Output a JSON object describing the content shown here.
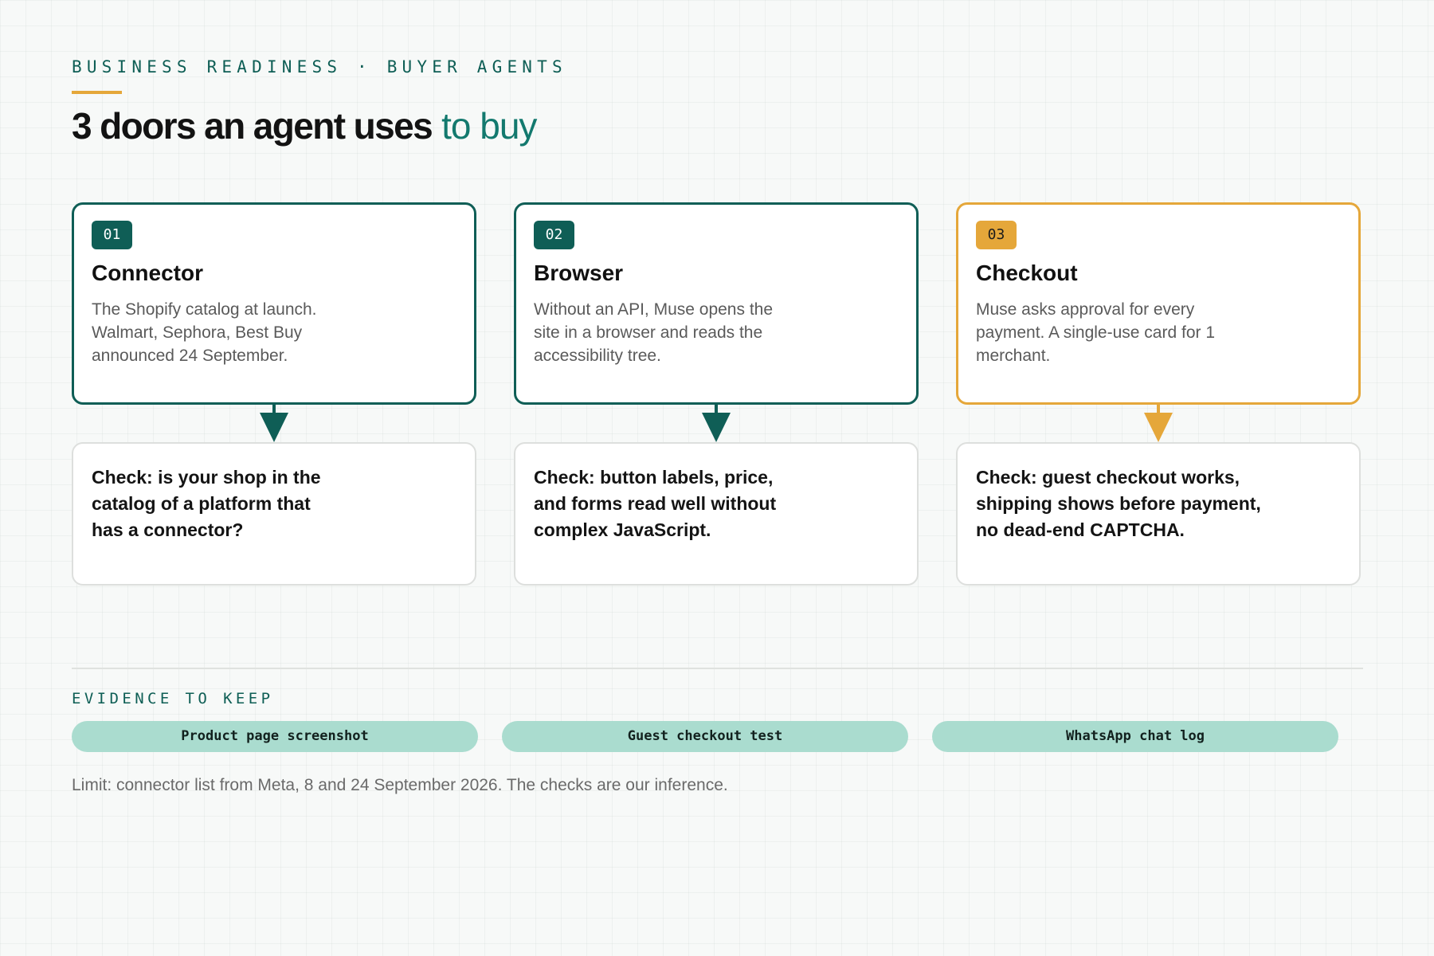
{
  "header": {
    "eyebrow": "BUSINESS READINESS · BUYER AGENTS",
    "title_main": "3 doors an agent uses",
    "title_accent": "to buy"
  },
  "doors": [
    {
      "badge": "01",
      "title": "Connector",
      "description": "The Shopify catalog at launch. Walmart, Sephora, Best Buy announced 24 September.",
      "check": "Check: is your shop in the catalog of a platform that has a connector?",
      "accent": "#0f5e56"
    },
    {
      "badge": "02",
      "title": "Browser",
      "description": "Without an API, Muse opens the site in a browser and reads the accessibility tree.",
      "check": "Check: button labels, price, and forms read well without complex JavaScript.",
      "accent": "#0f5e56"
    },
    {
      "badge": "03",
      "title": "Checkout",
      "description": "Muse asks approval for every payment. A single-use card for 1 merchant.",
      "check": "Check: guest checkout works, shipping shows before payment, no dead-end CAPTCHA.",
      "accent": "#e5a73a"
    }
  ],
  "evidence": {
    "label": "EVIDENCE TO KEEP",
    "items": [
      "Product page screenshot",
      "Guest checkout test",
      "WhatsApp chat log"
    ]
  },
  "footer": {
    "limit": "Limit: connector list from Meta, 8 and 24 September 2026. The checks are our inference."
  },
  "colors": {
    "primary": "#0f5e56",
    "accent_gold": "#e5a73a",
    "pill_bg": "#aadccf",
    "title_accent": "#13796e"
  }
}
